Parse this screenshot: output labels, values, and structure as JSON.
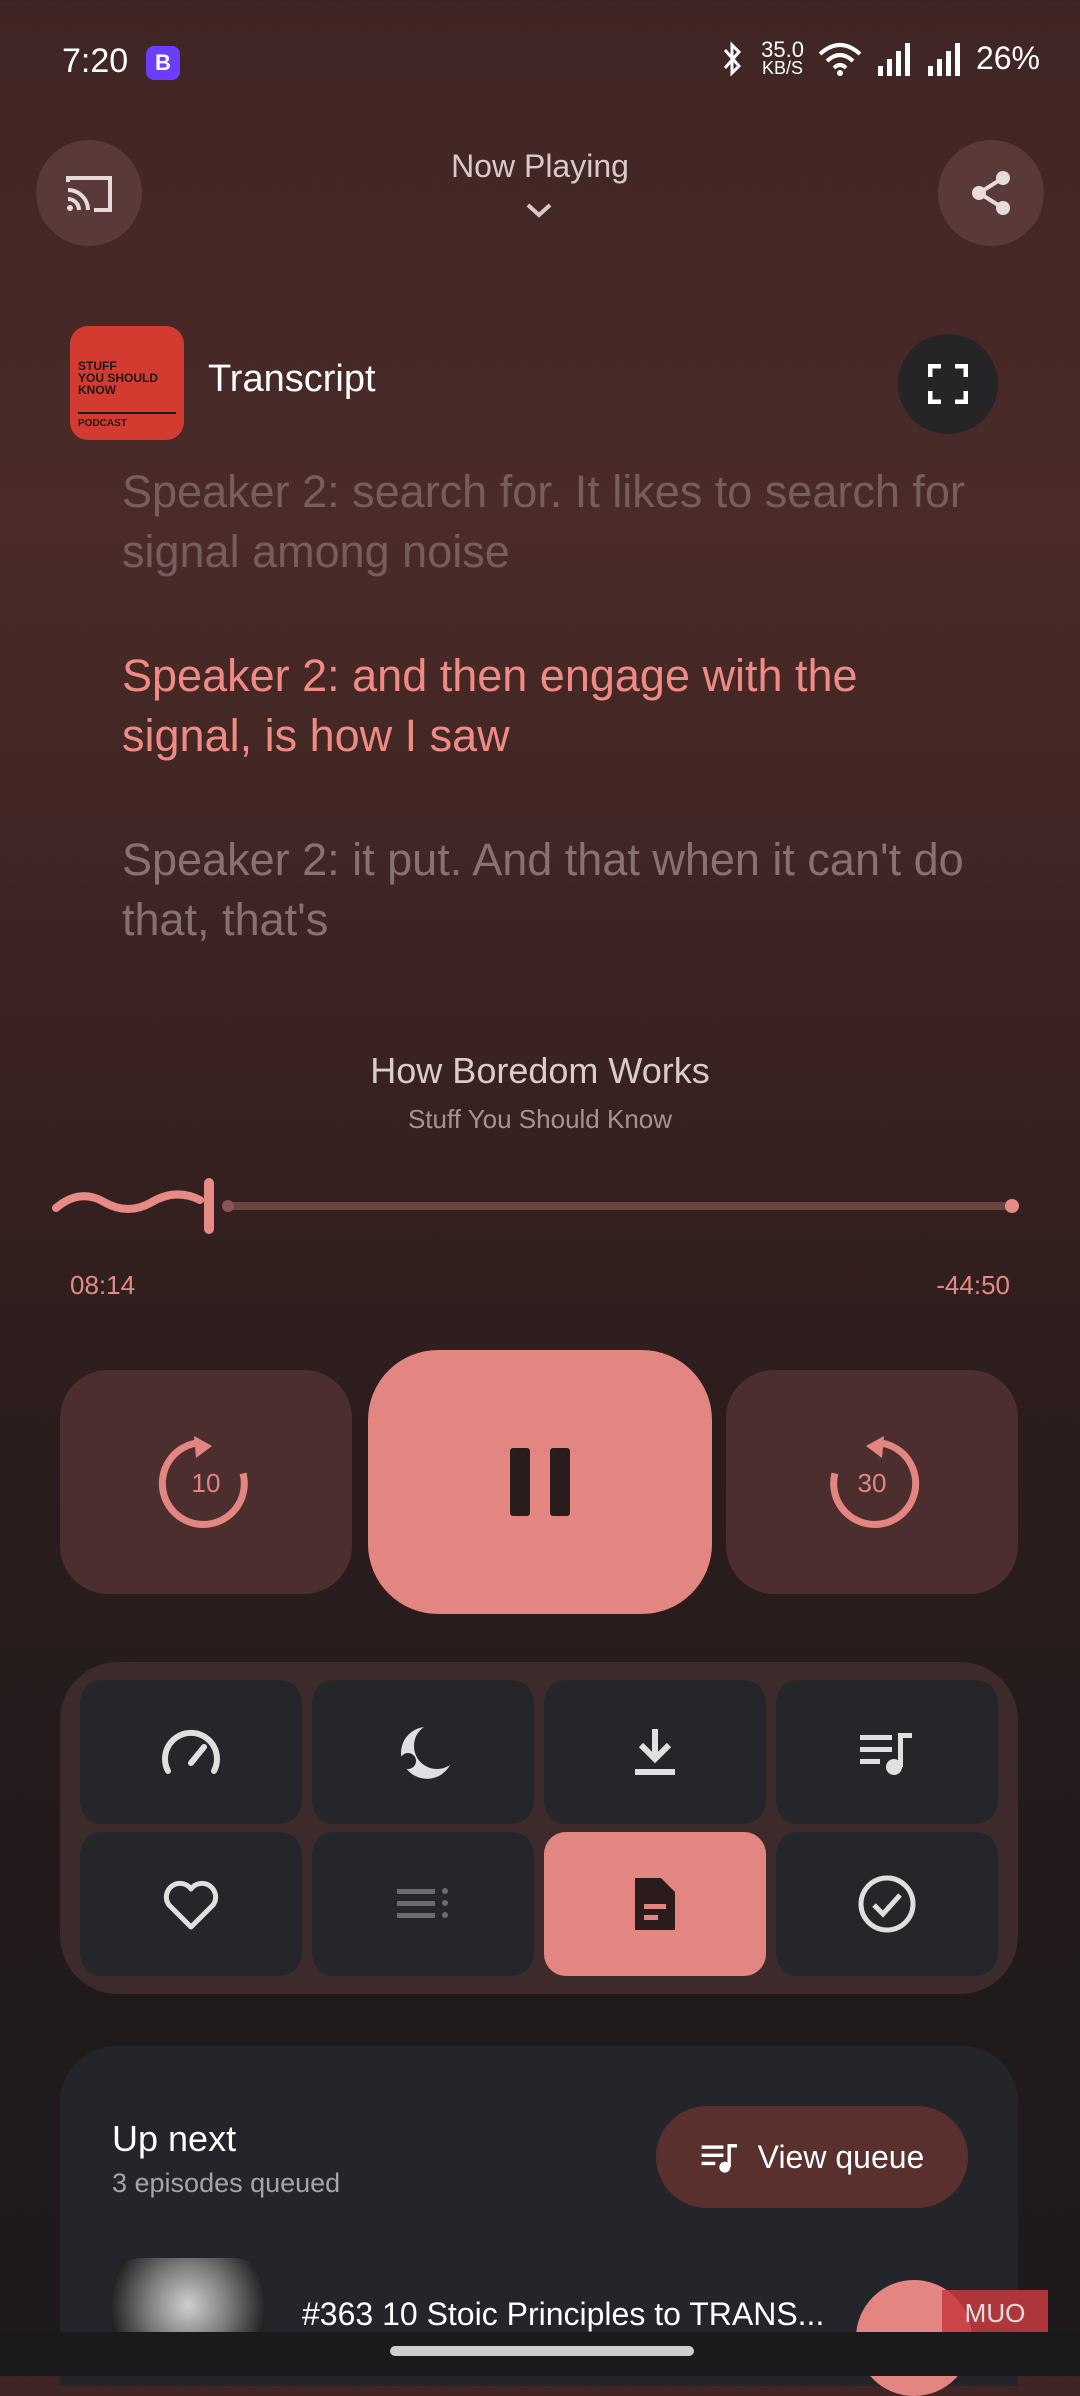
{
  "status": {
    "time": "7:20",
    "app_badge": "B",
    "speed_value": "35.0",
    "speed_unit": "KB/S",
    "battery": "26%"
  },
  "header": {
    "title": "Now Playing"
  },
  "transcript": {
    "title": "Transcript",
    "artwork": {
      "line1": "STUFF",
      "line2": "YOU SHOULD",
      "line3": "KNOW",
      "label": "PODCAST"
    },
    "lines": [
      "Speaker 2: search for. It likes to search for signal among noise",
      "Speaker 2: and then engage with the signal, is how I saw",
      "Speaker 2: it put. And that when it can't do that, that's"
    ]
  },
  "episode": {
    "title": "How Boredom Works",
    "show": "Stuff You Should Know",
    "elapsed": "08:14",
    "remaining": "-44:50",
    "progress_fraction": 0.155
  },
  "controls": {
    "rewind_seconds": "10",
    "forward_seconds": "30"
  },
  "actions": [
    {
      "icon": "speed-gauge-icon",
      "active": false
    },
    {
      "icon": "sleep-timer-moon-icon",
      "active": false
    },
    {
      "icon": "download-icon",
      "active": false
    },
    {
      "icon": "queue-music-icon",
      "active": false
    },
    {
      "icon": "heart-icon",
      "active": false
    },
    {
      "icon": "chapters-list-icon",
      "active": false
    },
    {
      "icon": "transcript-document-icon",
      "active": true
    },
    {
      "icon": "mark-played-check-icon",
      "active": false
    }
  ],
  "up_next": {
    "title": "Up next",
    "subtitle": "3 episodes queued",
    "view_queue_label": "View queue",
    "first_item_title": "#363 10 Stoic Principles to TRANS..."
  },
  "watermark": "MUO",
  "colors": {
    "accent": "#e38682",
    "accent_text": "#f08a84",
    "button_dark": "#25262a"
  }
}
